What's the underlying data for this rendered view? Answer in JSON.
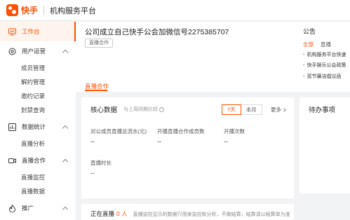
{
  "header": {
    "logo_text": "快手",
    "platform_title": "机构服务平台",
    "brand_color": "#ff5000"
  },
  "sidebar": {
    "items": [
      {
        "label": "工作台",
        "icon": "monitor-icon",
        "active": true
      },
      {
        "label": "用户运营",
        "icon": "user-settings-icon",
        "expanded": true,
        "children": [
          "成员管理",
          "解约管理",
          "邀约记录",
          "封禁查询"
        ]
      },
      {
        "label": "数据统计",
        "icon": "chart-bar-icon",
        "expanded": true,
        "children": [
          "直播分析"
        ]
      },
      {
        "label": "直播合作",
        "icon": "video-camera-icon",
        "expanded": true,
        "children": [
          "直播监控",
          "直播数据"
        ]
      },
      {
        "label": "推广",
        "icon": "flame-icon",
        "expanded": true,
        "children": []
      }
    ]
  },
  "main": {
    "page_title": "公司成立自己快手公会加微信号2275385707",
    "tag": "直播合作",
    "tab": "直播合作",
    "core": {
      "title": "核心数据",
      "subtitle": "与上周同期比较",
      "range_options": [
        "7天",
        "本月"
      ],
      "range_selected": "7天",
      "more": "更多",
      "metrics": [
        {
          "label": "对公成员直播总流水(元)",
          "value": "--"
        },
        {
          "label": "开播直播合作成员数",
          "value": "--"
        },
        {
          "label": "开播次数",
          "value": "--"
        },
        {
          "label": "直播时长",
          "value": "--"
        }
      ]
    },
    "live": {
      "label": "正在直播",
      "count": "0 人",
      "note": "直播监控显示的数据只用来监控和分析，不做结算，结算请以结算单为准"
    }
  },
  "right": {
    "notice": {
      "title": "公告",
      "tabs": [
        "全部",
        "直播"
      ],
      "items": [
        "机构服务平台快速",
        "快手娱乐公会政策",
        "双节廉洁倡议函"
      ]
    },
    "todo": {
      "title": "待办事项"
    }
  }
}
